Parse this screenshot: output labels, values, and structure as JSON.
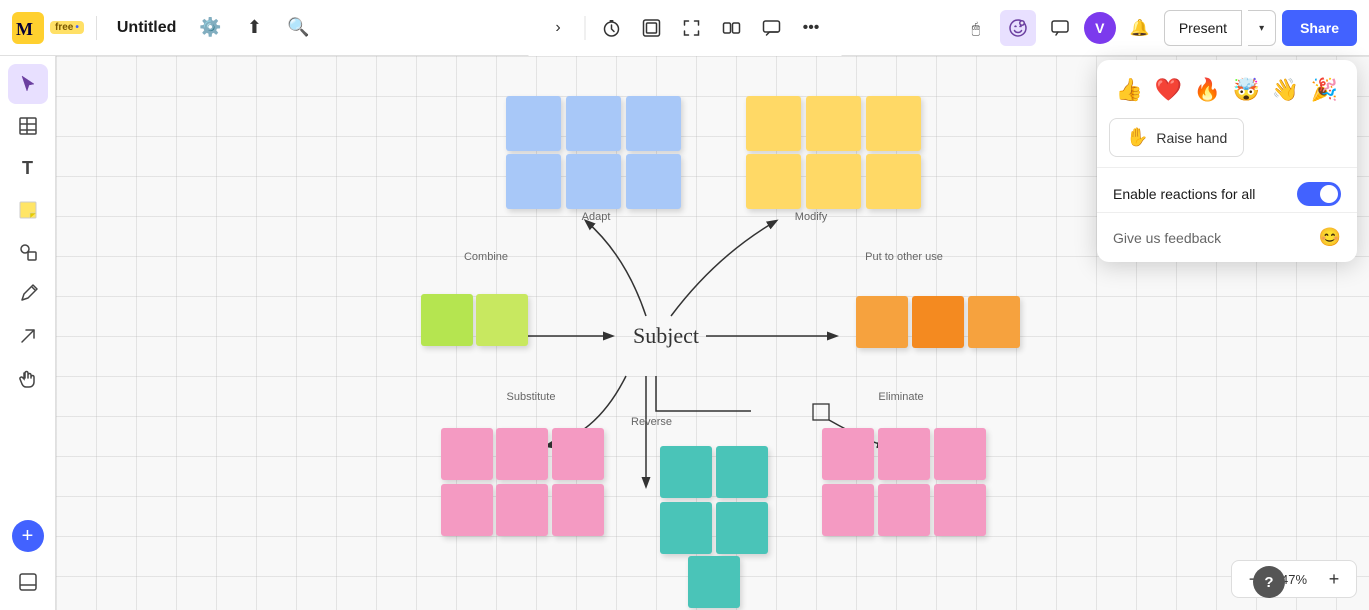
{
  "app": {
    "name": "miro",
    "plan": "free",
    "plan_dot_color": "#4262ff"
  },
  "header": {
    "title": "Untitled",
    "settings_tooltip": "Board settings",
    "share_tooltip": "Share",
    "search_tooltip": "Search"
  },
  "center_toolbar": {
    "buttons": [
      "›",
      "⏱",
      "⬜",
      "⛶",
      "🗐",
      "💬",
      "•••"
    ]
  },
  "right_toolbar": {
    "present_label": "Present",
    "share_label": "Share",
    "avatar_initials": "V",
    "avatar_color": "#7c3aed"
  },
  "sidebar": {
    "tools": [
      "cursor",
      "table",
      "text",
      "sticky",
      "shape",
      "pen",
      "arrow",
      "hand",
      "plus"
    ]
  },
  "zoom": {
    "level": "47%",
    "minus_label": "−",
    "plus_label": "+",
    "help_label": "?"
  },
  "canvas": {
    "subject_label": "Subject",
    "branches": [
      {
        "label": "Adapt",
        "direction": "up-left"
      },
      {
        "label": "Modify",
        "direction": "up-right"
      },
      {
        "label": "Combine",
        "direction": "left"
      },
      {
        "label": "Put to other use",
        "direction": "right"
      },
      {
        "label": "Substitute",
        "direction": "down-left"
      },
      {
        "label": "Reverse",
        "direction": "down"
      },
      {
        "label": "Eliminate",
        "direction": "down-right"
      }
    ]
  },
  "reactions_popup": {
    "emojis": [
      "👍",
      "❤️",
      "🔥",
      "🤯",
      "👋",
      "🎉"
    ],
    "raise_hand_label": "Raise hand",
    "enable_reactions_label": "Enable reactions for all",
    "enable_reactions_on": true,
    "feedback_label": "Give us feedback",
    "feedback_icon": "😊"
  }
}
